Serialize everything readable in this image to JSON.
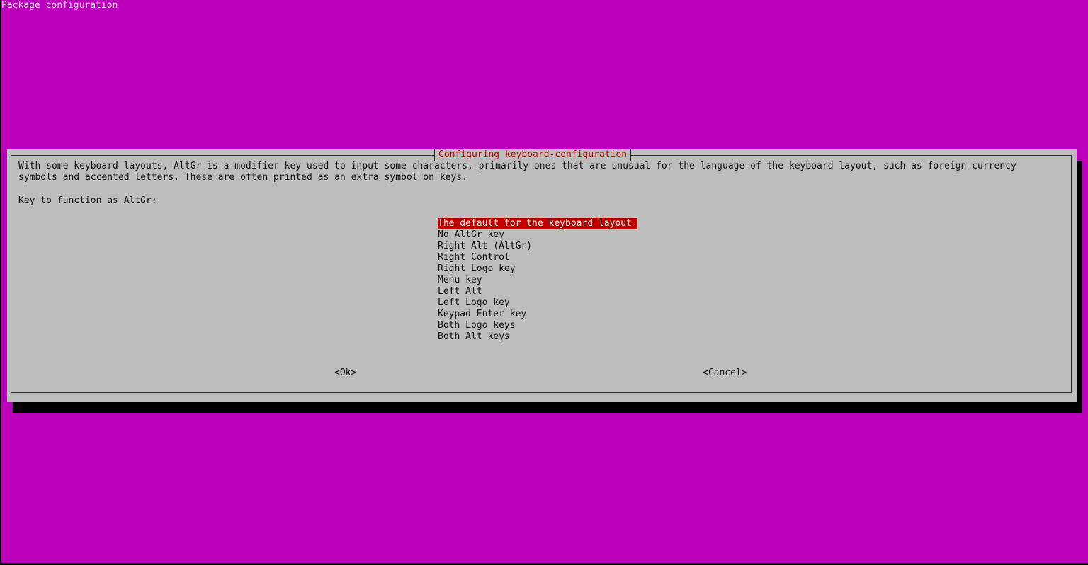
{
  "backtitle": "Package configuration",
  "dialog": {
    "title": "Configuring keyboard-configuration",
    "description_lines": [
      "With some keyboard layouts, AltGr is a modifier key used to input some characters, primarily ones that are unusual for the language of the keyboard layout, such as foreign currency",
      "symbols and accented letters. These are often printed as an extra symbol on keys."
    ],
    "prompt": "Key to function as AltGr:",
    "options": [
      "The default for the keyboard layout",
      "No AltGr key",
      "Right Alt (AltGr)",
      "Right Control",
      "Right Logo key",
      "Menu key",
      "Left Alt",
      "Left Logo key",
      "Keypad Enter key",
      "Both Logo keys",
      "Both Alt keys"
    ],
    "selected_option_index": 0,
    "ok_label": "<Ok>",
    "cancel_label": "<Cancel>"
  },
  "colors": {
    "background": "#bb00bb",
    "dialog": "#bdbdbd",
    "highlight": "#c00000",
    "title": "#c00000"
  }
}
